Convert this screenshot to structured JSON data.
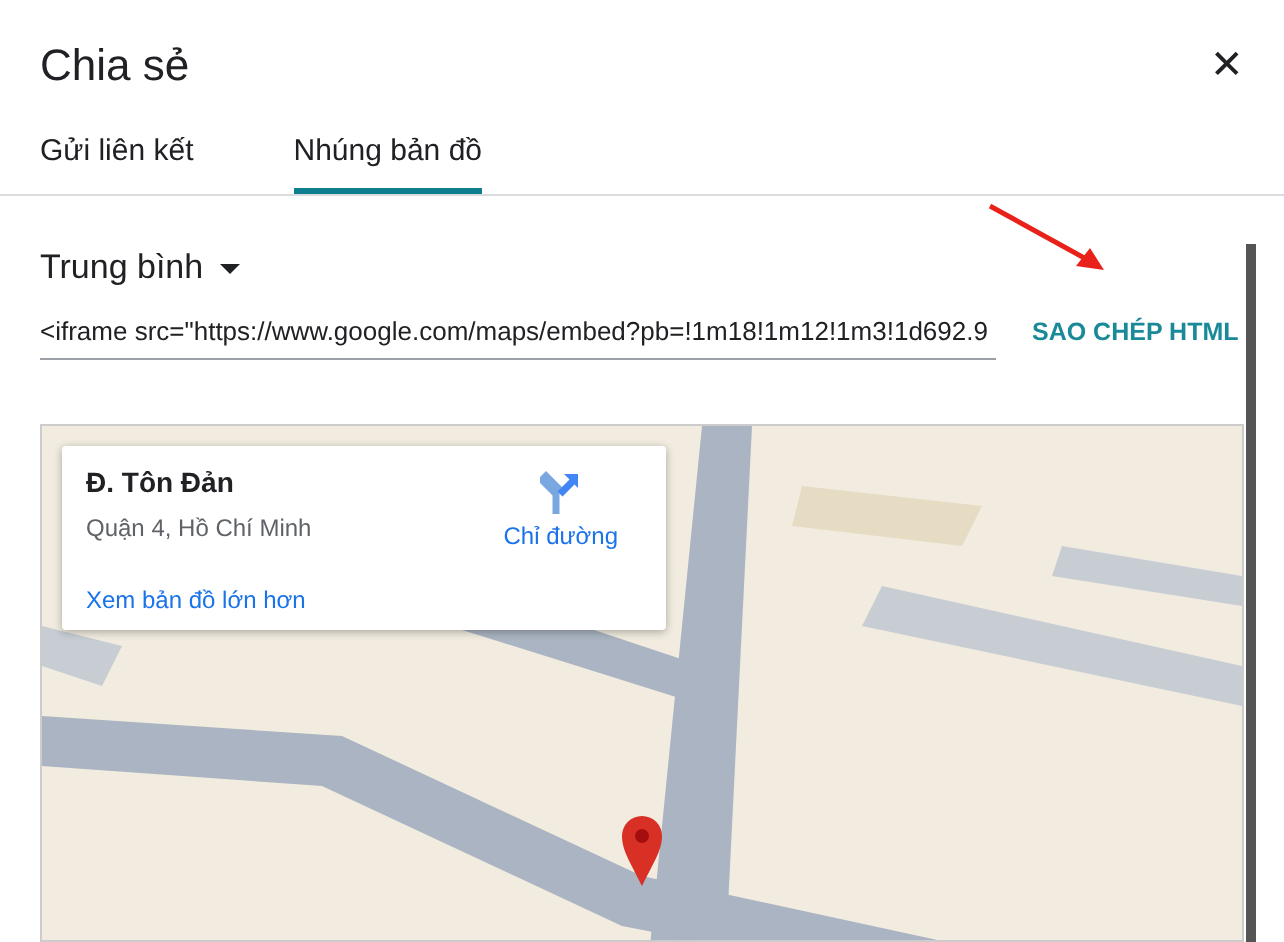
{
  "dialog": {
    "title": "Chia sẻ",
    "close": "✕"
  },
  "tabs": [
    {
      "label": "Gửi liên kết",
      "selected": false
    },
    {
      "label": "Nhúng bản đồ",
      "selected": true
    }
  ],
  "size_dropdown": {
    "value": "Trung bình"
  },
  "embed_code": {
    "value": "<iframe src=\"https://www.google.com/maps/embed?pb=!1m18!1m12!1m3!1d692.9"
  },
  "copy_button": "SAO CHÉP HTML",
  "map": {
    "place_card": {
      "name": "Đ. Tôn Đản",
      "address": "Quận 4, Hồ Chí Minh",
      "directions": "Chỉ đường",
      "larger_map_link": "Xem bản đồ lớn hơn"
    }
  }
}
